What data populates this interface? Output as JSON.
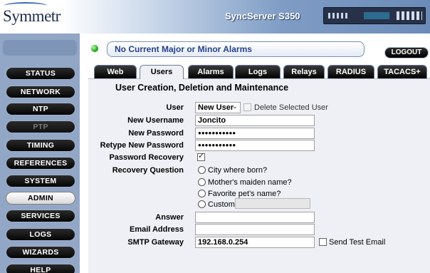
{
  "header": {
    "brand": "Symmetricom",
    "product": "SyncServer S350"
  },
  "nav": {
    "items": [
      {
        "label": "STATUS",
        "state": "normal"
      },
      {
        "label": "NETWORK",
        "state": "normal"
      },
      {
        "label": "NTP",
        "state": "normal"
      },
      {
        "label": "PTP",
        "state": "disabled"
      },
      {
        "label": "TIMING",
        "state": "normal"
      },
      {
        "label": "REFERENCES",
        "state": "normal"
      },
      {
        "label": "SYSTEM",
        "state": "normal"
      },
      {
        "label": "ADMIN",
        "state": "active"
      },
      {
        "label": "SERVICES",
        "state": "normal"
      },
      {
        "label": "LOGS",
        "state": "normal"
      },
      {
        "label": "WIZARDS",
        "state": "normal"
      },
      {
        "label": "HELP",
        "state": "normal"
      }
    ]
  },
  "alarm": {
    "status_color": "#1fa81f",
    "message": "No Current Major or Minor Alarms"
  },
  "logout_label": "LOGOUT",
  "tabs": [
    {
      "label": "Web",
      "active": false
    },
    {
      "label": "Users",
      "active": true
    },
    {
      "label": "Alarms",
      "active": false
    },
    {
      "label": "Logs Config",
      "active": false
    },
    {
      "label": "Relays",
      "active": false
    },
    {
      "label": "RADIUS",
      "active": false
    },
    {
      "label": "TACACS+",
      "active": false
    }
  ],
  "form": {
    "title": "User Creation, Deletion and Maintenance",
    "user_label": "User",
    "user_value": "New User",
    "delete_label": "Delete Selected User",
    "new_username_label": "New Username",
    "new_username_value": "Joncito",
    "new_password_label": "New Password",
    "new_password_value": "●●●●●●●●●●●",
    "retype_password_label": "Retype New Password",
    "retype_password_value": "●●●●●●●●●●●",
    "password_recovery_label": "Password Recovery",
    "password_recovery_checked": true,
    "recovery_question_label": "Recovery Question",
    "recovery_options": [
      "City where born?",
      "Mother's maiden name?",
      "Favorite pet's name?",
      "Custom"
    ],
    "answer_label": "Answer",
    "answer_value": "",
    "email_label": "Email Address",
    "email_value": "",
    "smtp_label": "SMTP Gateway",
    "smtp_value": "192.168.0.254",
    "send_test_label": "Send Test Email"
  }
}
